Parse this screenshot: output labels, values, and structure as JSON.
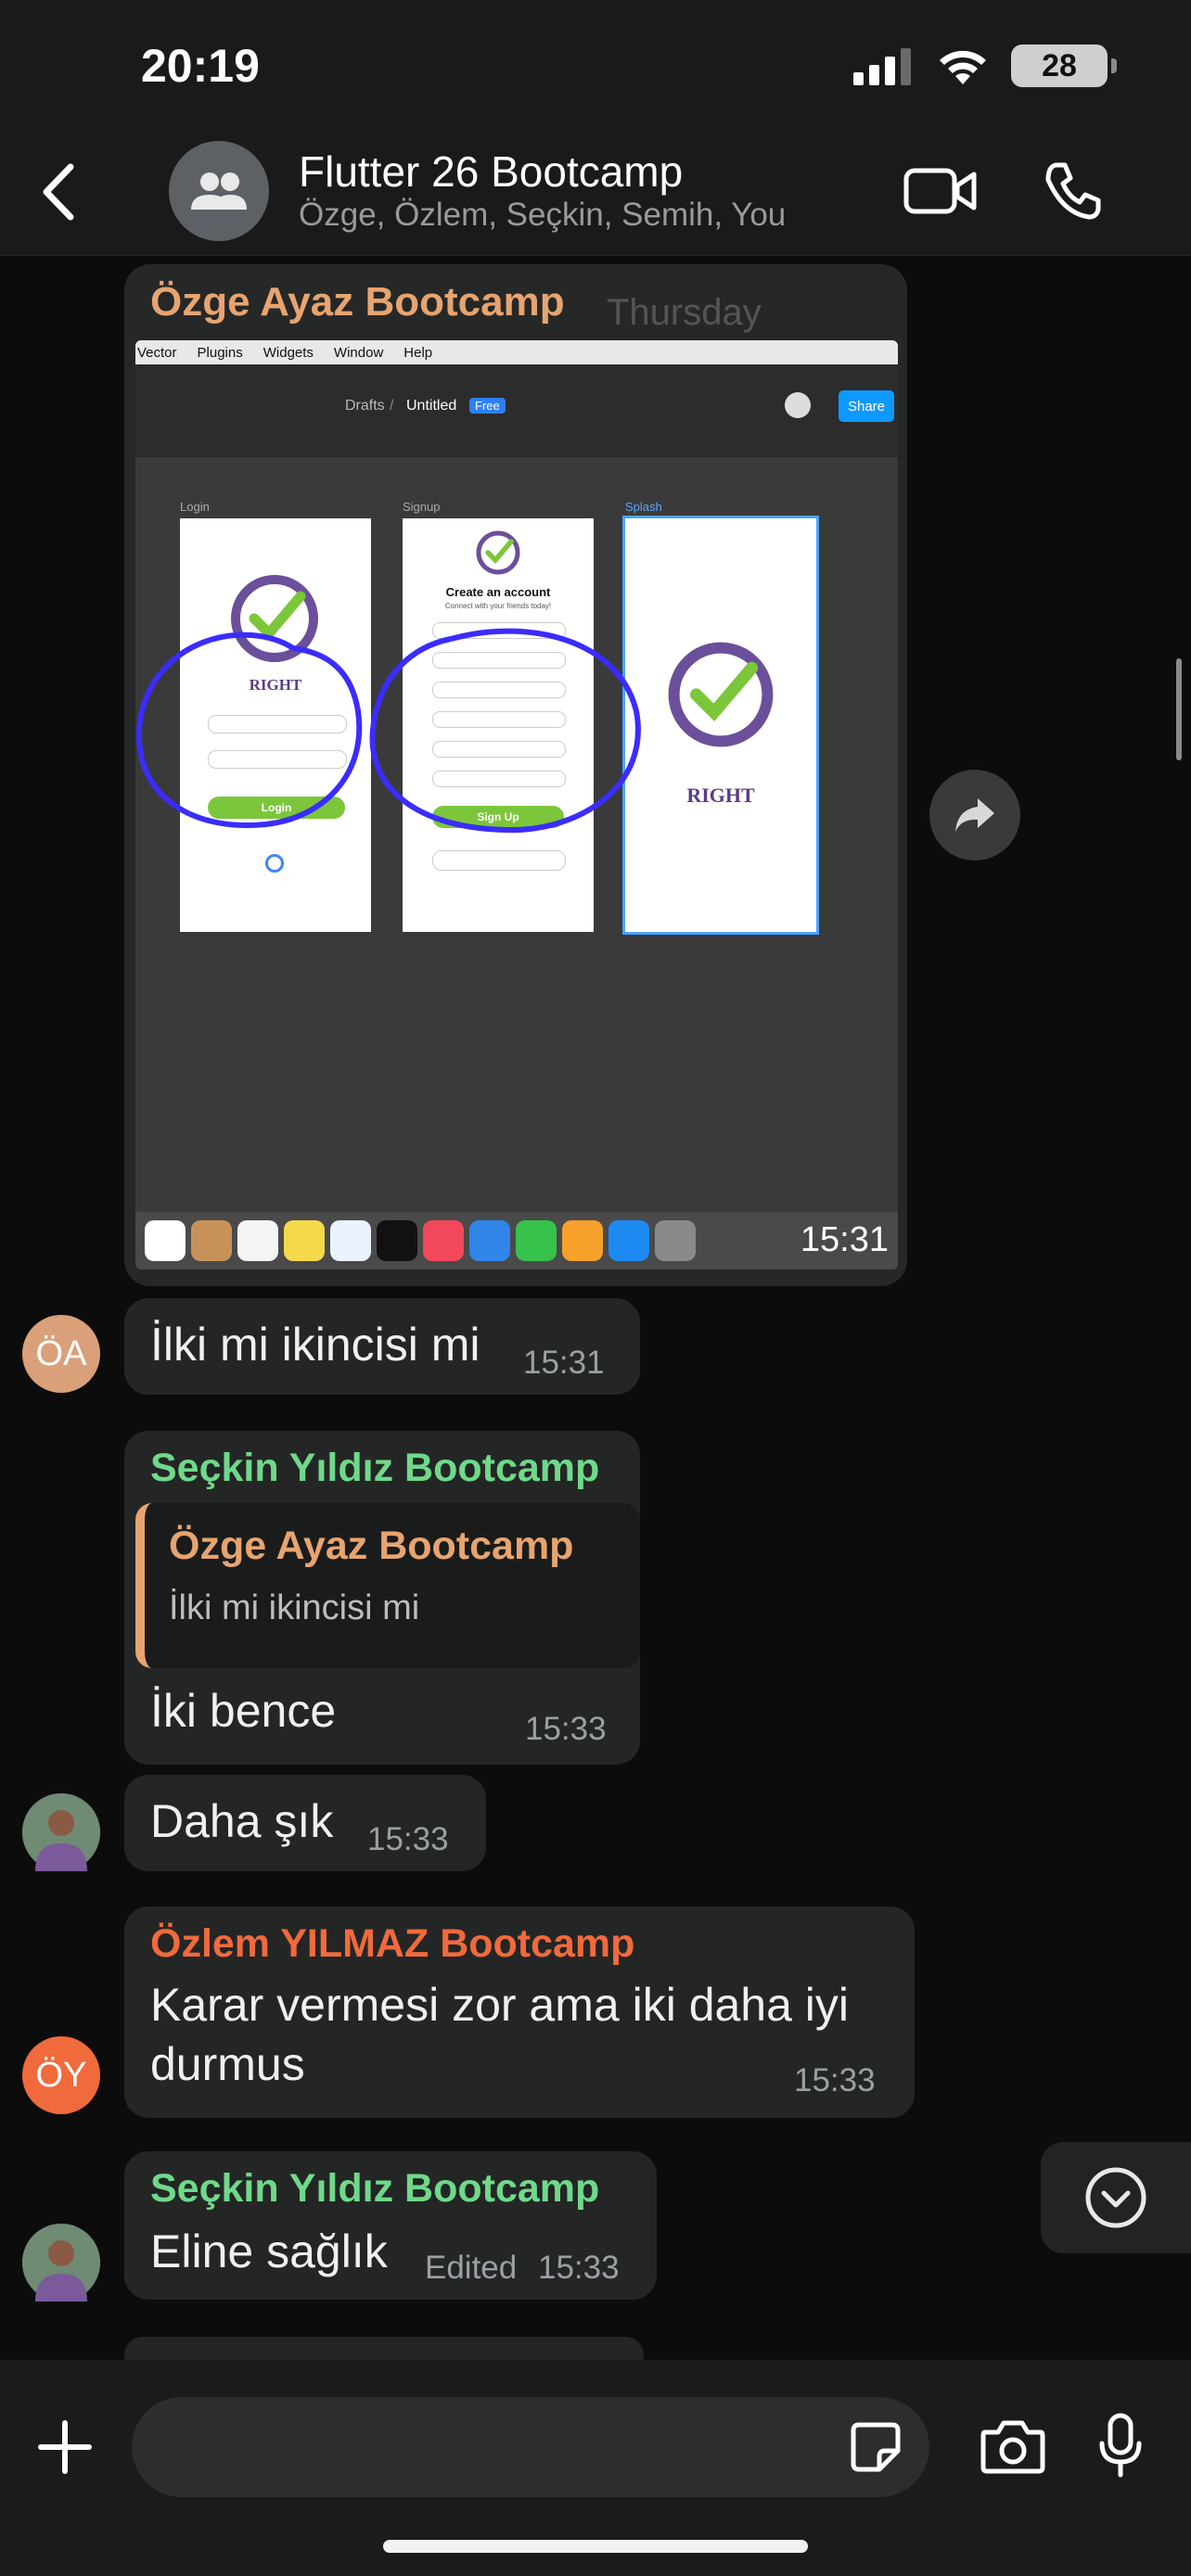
{
  "status_bar": {
    "time": "20:19",
    "battery": "28"
  },
  "header": {
    "title": "Flutter 26 Bootcamp",
    "subtitle": "Özge, Özlem, Seçkin, Semih, You"
  },
  "image_message": {
    "sender": "Özge Ayaz Bootcamp",
    "date_overlay": "Thursday",
    "time": "15:31",
    "screenshot": {
      "menu": [
        "Vector",
        "Plugins",
        "Widgets",
        "Window",
        "Help"
      ],
      "breadcrumb_drafts": "Drafts",
      "breadcrumb_sep": "/",
      "file_name": "Untitled",
      "plan_badge": "Free",
      "share_label": "Share",
      "frames": [
        {
          "label": "Login",
          "brand": "RIGHT",
          "button": "Login"
        },
        {
          "label": "Signup",
          "heading": "Create an account",
          "sub": "Connect with your friends today!",
          "button": "Sign Up"
        },
        {
          "label": "Splash",
          "brand": "RIGHT"
        }
      ]
    }
  },
  "messages": [
    {
      "avatar": "ÖA",
      "text": "İlki mi ikincisi mi",
      "time": "15:31"
    },
    {
      "sender": "Seçkin Yıldız Bootcamp",
      "quote_sender": "Özge Ayaz Bootcamp",
      "quote_text": "İlki mi ikincisi mi",
      "text": "İki bence",
      "time": "15:33"
    },
    {
      "text": "Daha şık",
      "time": "15:33"
    },
    {
      "sender": "Özlem YILMAZ Bootcamp",
      "avatar": "ÖY",
      "text_line1": "Karar vermesi zor ama iki daha iyi",
      "text_line2": "durmus",
      "time": "15:33"
    },
    {
      "sender": "Seçkin Yıldız Bootcamp",
      "text": "Eline sağlık",
      "edited": "Edited",
      "time": "15:33"
    }
  ],
  "colors": {
    "ozge": "#e7a46f",
    "seckin": "#6fd98a",
    "ozlem": "#f06a3c",
    "bubble": "#242626"
  },
  "icons": [
    "back-chevron-icon",
    "group-avatar-icon",
    "video-call-icon",
    "phone-call-icon",
    "forward-icon",
    "scroll-down-icon",
    "plus-icon",
    "sticker-icon",
    "camera-icon",
    "microphone-icon"
  ]
}
